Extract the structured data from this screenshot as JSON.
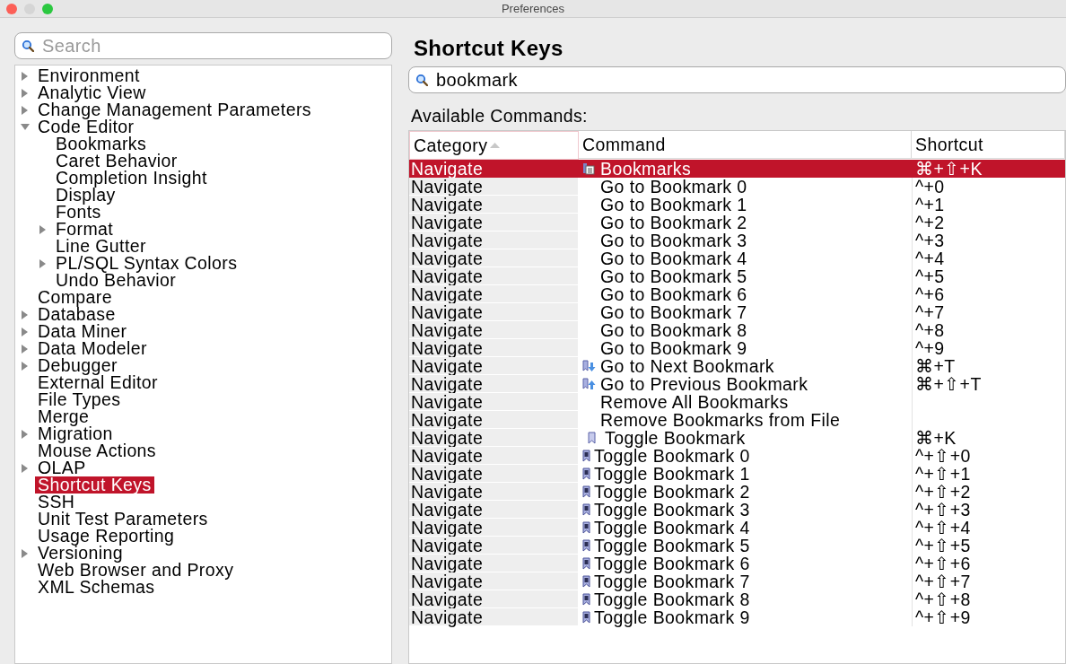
{
  "window": {
    "title": "Preferences"
  },
  "sidebar": {
    "search": {
      "placeholder": "Search"
    },
    "items": [
      {
        "label": "Environment",
        "expanded": false,
        "selected": false
      },
      {
        "label": "Analytic View",
        "expanded": false,
        "selected": false
      },
      {
        "label": "Change Management Parameters",
        "expanded": false,
        "selected": false
      },
      {
        "label": "Code Editor",
        "expanded": true,
        "selected": false,
        "children": [
          {
            "label": "Bookmarks",
            "selected": false
          },
          {
            "label": "Caret Behavior",
            "selected": false
          },
          {
            "label": "Completion Insight",
            "selected": false
          },
          {
            "label": "Display",
            "selected": false
          },
          {
            "label": "Fonts",
            "selected": false
          },
          {
            "label": "Format",
            "expanded": false,
            "selected": false
          },
          {
            "label": "Line Gutter",
            "selected": false
          },
          {
            "label": "PL/SQL Syntax Colors",
            "expanded": false,
            "selected": false
          },
          {
            "label": "Undo Behavior",
            "selected": false
          }
        ]
      },
      {
        "label": "Compare",
        "selected": false
      },
      {
        "label": "Database",
        "expanded": false,
        "selected": false
      },
      {
        "label": "Data Miner",
        "expanded": false,
        "selected": false
      },
      {
        "label": "Data Modeler",
        "expanded": false,
        "selected": false
      },
      {
        "label": "Debugger",
        "expanded": false,
        "selected": false
      },
      {
        "label": "External Editor",
        "selected": false
      },
      {
        "label": "File Types",
        "selected": false
      },
      {
        "label": "Merge",
        "selected": false
      },
      {
        "label": "Migration",
        "expanded": false,
        "selected": false
      },
      {
        "label": "Mouse Actions",
        "selected": false
      },
      {
        "label": "OLAP",
        "expanded": false,
        "selected": false
      },
      {
        "label": "Shortcut Keys",
        "selected": true
      },
      {
        "label": "SSH",
        "selected": false
      },
      {
        "label": "Unit Test Parameters",
        "selected": false
      },
      {
        "label": "Usage Reporting",
        "selected": false
      },
      {
        "label": "Versioning",
        "expanded": false,
        "selected": false
      },
      {
        "label": "Web Browser and Proxy",
        "selected": false
      },
      {
        "label": "XML Schemas",
        "selected": false
      }
    ]
  },
  "panel": {
    "title": "Shortcut Keys",
    "filter": {
      "value": "bookmark"
    },
    "table_label": "Available Commands:",
    "table": {
      "columns": [
        {
          "label": "Category",
          "sorted": true
        },
        {
          "label": "Command",
          "sorted": false
        },
        {
          "label": "Shortcut",
          "sorted": false
        }
      ],
      "rows": [
        {
          "category": "Navigate",
          "kind": "bookmarks",
          "command": "Bookmarks",
          "shortcut": "⌘+⇧+K",
          "selected": true
        },
        {
          "category": "Navigate",
          "kind": "plain",
          "command": "Go to Bookmark 0",
          "shortcut": "^+0",
          "selected": false
        },
        {
          "category": "Navigate",
          "kind": "plain",
          "command": "Go to Bookmark 1",
          "shortcut": "^+1",
          "selected": false
        },
        {
          "category": "Navigate",
          "kind": "plain",
          "command": "Go to Bookmark 2",
          "shortcut": "^+2",
          "selected": false
        },
        {
          "category": "Navigate",
          "kind": "plain",
          "command": "Go to Bookmark 3",
          "shortcut": "^+3",
          "selected": false
        },
        {
          "category": "Navigate",
          "kind": "plain",
          "command": "Go to Bookmark 4",
          "shortcut": "^+4",
          "selected": false
        },
        {
          "category": "Navigate",
          "kind": "plain",
          "command": "Go to Bookmark 5",
          "shortcut": "^+5",
          "selected": false
        },
        {
          "category": "Navigate",
          "kind": "plain",
          "command": "Go to Bookmark 6",
          "shortcut": "^+6",
          "selected": false
        },
        {
          "category": "Navigate",
          "kind": "plain",
          "command": "Go to Bookmark 7",
          "shortcut": "^+7",
          "selected": false
        },
        {
          "category": "Navigate",
          "kind": "plain",
          "command": "Go to Bookmark 8",
          "shortcut": "^+8",
          "selected": false
        },
        {
          "category": "Navigate",
          "kind": "plain",
          "command": "Go to Bookmark 9",
          "shortcut": "^+9",
          "selected": false
        },
        {
          "category": "Navigate",
          "kind": "next",
          "command": "Go to Next Bookmark",
          "shortcut": "⌘+T",
          "selected": false
        },
        {
          "category": "Navigate",
          "kind": "previous",
          "command": "Go to Previous Bookmark",
          "shortcut": "⌘+⇧+T",
          "selected": false
        },
        {
          "category": "Navigate",
          "kind": "plain",
          "command": "Remove All Bookmarks",
          "selected": false
        },
        {
          "category": "Navigate",
          "kind": "plain",
          "command": "Remove Bookmarks from File",
          "selected": false
        },
        {
          "category": "Navigate",
          "kind": "bookmark",
          "command": "Toggle Bookmark",
          "shortcut": "⌘+K",
          "selected": false
        },
        {
          "category": "Navigate",
          "kind": "numbered",
          "command": "Toggle Bookmark 0",
          "shortcut": "^+⇧+0",
          "selected": false
        },
        {
          "category": "Navigate",
          "kind": "numbered",
          "command": "Toggle Bookmark 1",
          "shortcut": "^+⇧+1",
          "selected": false
        },
        {
          "category": "Navigate",
          "kind": "numbered",
          "command": "Toggle Bookmark 2",
          "shortcut": "^+⇧+2",
          "selected": false
        },
        {
          "category": "Navigate",
          "kind": "numbered",
          "command": "Toggle Bookmark 3",
          "shortcut": "^+⇧+3",
          "selected": false
        },
        {
          "category": "Navigate",
          "kind": "numbered",
          "command": "Toggle Bookmark 4",
          "shortcut": "^+⇧+4",
          "selected": false
        },
        {
          "category": "Navigate",
          "kind": "numbered",
          "command": "Toggle Bookmark 5",
          "shortcut": "^+⇧+5",
          "selected": false
        },
        {
          "category": "Navigate",
          "kind": "numbered",
          "command": "Toggle Bookmark 6",
          "shortcut": "^+⇧+6",
          "selected": false
        },
        {
          "category": "Navigate",
          "kind": "numbered",
          "command": "Toggle Bookmark 7",
          "shortcut": "^+⇧+7",
          "selected": false
        },
        {
          "category": "Navigate",
          "kind": "numbered",
          "command": "Toggle Bookmark 8",
          "shortcut": "^+⇧+8",
          "selected": false
        },
        {
          "category": "Navigate",
          "kind": "numbered",
          "command": "Toggle Bookmark 9",
          "shortcut": "^+⇧+9",
          "selected": false
        }
      ]
    }
  }
}
